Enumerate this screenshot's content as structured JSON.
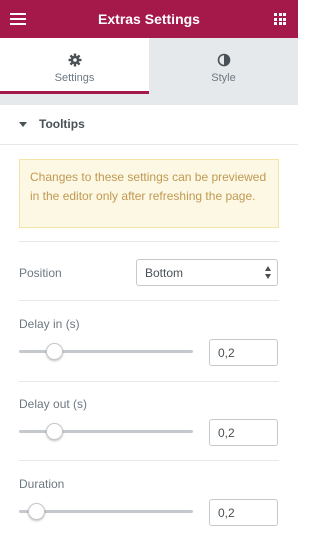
{
  "header": {
    "title": "Extras Settings",
    "menu_icon": "hamburger-icon",
    "apps_icon": "grid-icon"
  },
  "tabs": [
    {
      "label": "Settings",
      "icon": "gear-icon",
      "active": true
    },
    {
      "label": "Style",
      "icon": "contrast-icon",
      "active": false
    }
  ],
  "section": {
    "title": "Tooltips",
    "expanded": true
  },
  "notice": {
    "text": "Changes to these settings can be previewed in the editor only after refreshing the page."
  },
  "position": {
    "label": "Position",
    "value": "Bottom"
  },
  "delay_in": {
    "label": "Delay in (s)",
    "value": "0,2",
    "slider_fraction": 0.2
  },
  "delay_out": {
    "label": "Delay out (s)",
    "value": "0,2",
    "slider_fraction": 0.2
  },
  "duration": {
    "label": "Duration",
    "value": "0,2",
    "slider_fraction": 0.1
  },
  "colors": {
    "brand": "#a4194a",
    "panel_bg": "#e6e9ec",
    "notice_bg": "#fcf8e3",
    "notice_text": "#c09853"
  }
}
